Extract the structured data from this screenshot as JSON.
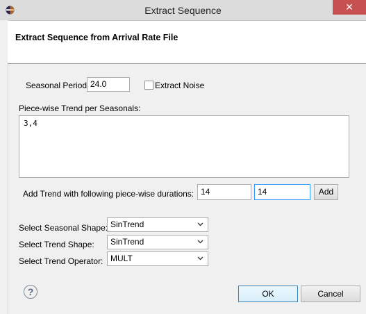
{
  "window": {
    "title": "Extract Sequence",
    "close_glyph": "✕"
  },
  "header": {
    "title": "Extract Sequence from Arrival Rate File"
  },
  "form": {
    "seasonal_period_label": "Seasonal Period:",
    "seasonal_period_value": "24.0",
    "extract_noise_label": "Extract Noise",
    "extract_noise_checked": false,
    "trend_label": "Piece-wise Trend per Seasonals:",
    "trend_value": "3,4",
    "add_trend_label": "Add Trend with following piece-wise durations:",
    "duration_1_value": "14",
    "duration_2_value": "14",
    "add_button_label": "Add",
    "seasonal_shape_label": "Select Seasonal Shape:",
    "seasonal_shape_value": "SinTrend",
    "trend_shape_label": "Select Trend Shape:",
    "trend_shape_value": "SinTrend",
    "trend_operator_label": "Select Trend Operator:",
    "trend_operator_value": "MULT"
  },
  "footer": {
    "help_glyph": "?",
    "ok_label": "OK",
    "cancel_label": "Cancel"
  },
  "icons": {
    "app": "eclipse-icon",
    "help": "help-icon",
    "chevron": "chevron-down-icon"
  },
  "colors": {
    "close_button": "#c75050",
    "focus_border": "#3399ff",
    "body_background": "#f0f0f0"
  }
}
